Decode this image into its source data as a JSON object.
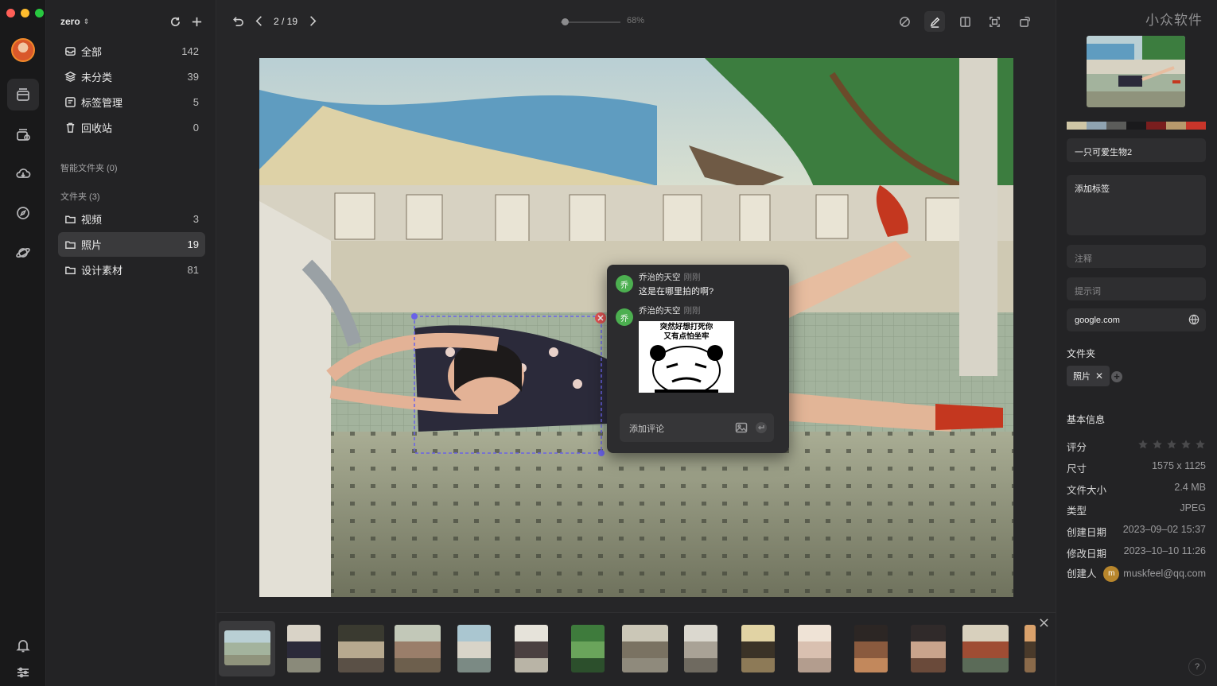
{
  "window": {
    "traffic_colors": [
      "#ff5f57",
      "#febc2e",
      "#28c840"
    ]
  },
  "rail": {
    "items": [
      "library-icon",
      "archive-icon",
      "cloud-icon",
      "explore-icon",
      "planet-icon"
    ],
    "bottom": [
      "bell-icon",
      "sliders-icon"
    ]
  },
  "sidebar": {
    "workspace": "zero",
    "nav": [
      {
        "label": "全部",
        "count": "142",
        "icon": "inbox-icon"
      },
      {
        "label": "未分类",
        "count": "39",
        "icon": "layers-icon"
      },
      {
        "label": "标签管理",
        "count": "5",
        "icon": "tag-icon"
      },
      {
        "label": "回收站",
        "count": "0",
        "icon": "trash-icon"
      }
    ],
    "smart_folders_title": "智能文件夹 (0)",
    "folders_title": "文件夹 (3)",
    "folders": [
      {
        "label": "视频",
        "count": "3"
      },
      {
        "label": "照片",
        "count": "19",
        "active": true
      },
      {
        "label": "设计素材",
        "count": "81"
      }
    ]
  },
  "toolbar": {
    "page": "2 / 19",
    "zoom": "68%",
    "zoom_fraction": 0.02
  },
  "comments": {
    "items": [
      {
        "avatar": "乔",
        "author": "乔治的天空",
        "time": "刚刚",
        "text": "这是在哪里拍的啊?"
      },
      {
        "avatar": "乔",
        "author": "乔治的天空",
        "time": "刚刚",
        "meme_caption": [
          "突然好想打死你",
          "又有点怕坐牢"
        ]
      }
    ],
    "reply_placeholder": "添加评论"
  },
  "right": {
    "watermark": "小众软件",
    "palette": [
      "#cfc6a6",
      "#8fa3b1",
      "#5b5c5a",
      "#1a1a1c",
      "#7a1e1e",
      "#b8996c",
      "#c8352a"
    ],
    "title": "一只可爱生物2",
    "tags_placeholder": "添加标签",
    "note_placeholder": "注释",
    "prompt_placeholder": "提示词",
    "url": "google.com",
    "folder_label": "文件夹",
    "folder_chip": "照片",
    "basic_info_label": "基本信息",
    "rating": 0,
    "info": [
      {
        "k": "评分",
        "v": ""
      },
      {
        "k": "尺寸",
        "v": "1575 x 1125"
      },
      {
        "k": "文件大小",
        "v": "2.4 MB"
      },
      {
        "k": "类型",
        "v": "JPEG"
      },
      {
        "k": "创建日期",
        "v": "2023–09–02 15:37"
      },
      {
        "k": "修改日期",
        "v": "2023–10–10 11:26"
      }
    ],
    "creator_label": "创建人",
    "creator_avatar": "m",
    "creator_email": "muskfeel@qq.com",
    "help": "?"
  }
}
